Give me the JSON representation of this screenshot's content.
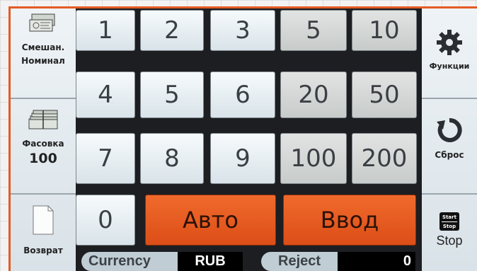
{
  "left_panel": {
    "mixed": {
      "line1": "Смешан.",
      "line2": "Номинал",
      "icon": "banknotes-icon"
    },
    "batch": {
      "label": "Фасовка",
      "value": "100",
      "icon": "banknote-stack-icon"
    },
    "return": {
      "label": "Возврат",
      "icon": "page-icon"
    }
  },
  "keypad": {
    "digits": [
      "1",
      "2",
      "3",
      "4",
      "5",
      "6",
      "7",
      "8",
      "9",
      "0"
    ],
    "denominations": [
      "5",
      "10",
      "20",
      "50",
      "100",
      "200"
    ],
    "auto_label": "Авто",
    "enter_label": "Ввод"
  },
  "right_panel": {
    "functions": {
      "label": "Функции",
      "icon": "gear-icon"
    },
    "reset": {
      "label": "Сброс",
      "icon": "reset-arrow-icon"
    },
    "startstop": {
      "label": "Stop",
      "badge_top": "Start",
      "badge_bottom": "Stop",
      "icon": "start-stop-badge-icon"
    }
  },
  "status_bar": {
    "currency_label": "Currency",
    "currency_value": "RUB",
    "reject_label": "Reject",
    "reject_value": "0"
  },
  "colors": {
    "accent": "#e35b25",
    "panel": "#1c1e22",
    "key": "#e9eff2"
  }
}
